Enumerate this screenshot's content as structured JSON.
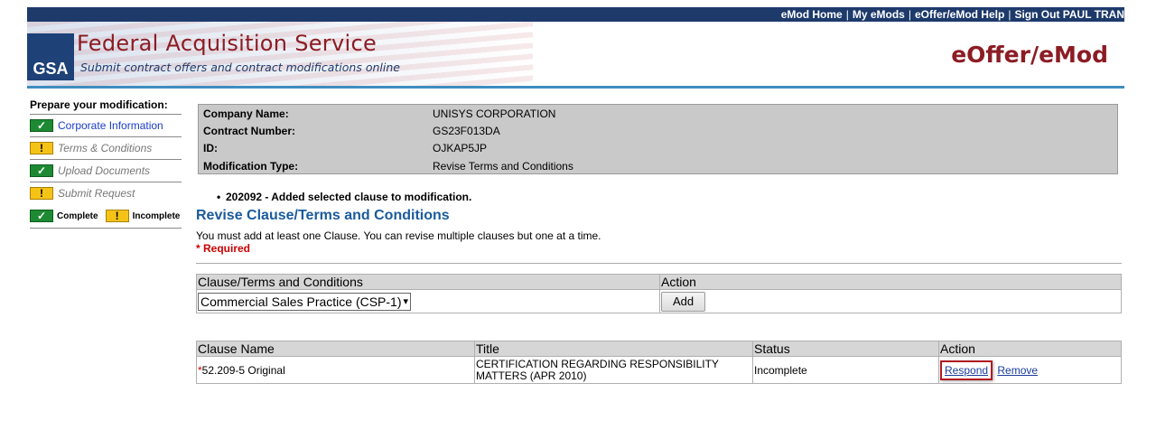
{
  "topnav": {
    "links": [
      "eMod Home",
      "My eMods",
      "eOffer/eMod Help",
      "Sign Out PAUL TRAN"
    ]
  },
  "banner": {
    "logo": "GSA",
    "title": "Federal Acquisition Service",
    "subtitle": "Submit contract offers and contract modifications online",
    "app_title": "eOffer/eMod"
  },
  "sidebar": {
    "title": "Prepare your modification:",
    "items": [
      {
        "label": "Corporate Information",
        "status": "complete"
      },
      {
        "label": "Terms & Conditions",
        "status": "incomplete"
      },
      {
        "label": "Upload Documents",
        "status": "complete"
      },
      {
        "label": "Submit Request",
        "status": "incomplete"
      }
    ],
    "legend": {
      "complete": "Complete",
      "incomplete": "Incomplete"
    }
  },
  "company": {
    "rows": [
      {
        "label": "Company Name:",
        "value": "UNISYS CORPORATION"
      },
      {
        "label": "Contract Number:",
        "value": "GS23F013DA"
      },
      {
        "label": "ID:",
        "value": "OJKAP5JP"
      },
      {
        "label": "Modification Type:",
        "value": "Revise Terms and Conditions"
      }
    ]
  },
  "message": "202092 - Added selected clause to modification.",
  "section": {
    "title": "Revise Clause/Terms and Conditions",
    "instructions": "You must add at least one Clause. You can revise multiple clauses but one at a time.",
    "required": "* Required"
  },
  "add_table": {
    "headers": [
      "Clause/Terms and Conditions",
      "Action"
    ],
    "selected_clause": "Commercial Sales Practice (CSP-1)",
    "add_label": "Add"
  },
  "clause_table": {
    "headers": [
      "Clause Name",
      "Title",
      "Status",
      "Action"
    ],
    "rows": [
      {
        "required_mark": "*",
        "name": "52.209-5 Original",
        "title": "CERTIFICATION REGARDING RESPONSIBILITY MATTERS (APR 2010)",
        "status": "Incomplete",
        "respond": "Respond",
        "remove": "Remove"
      }
    ]
  }
}
